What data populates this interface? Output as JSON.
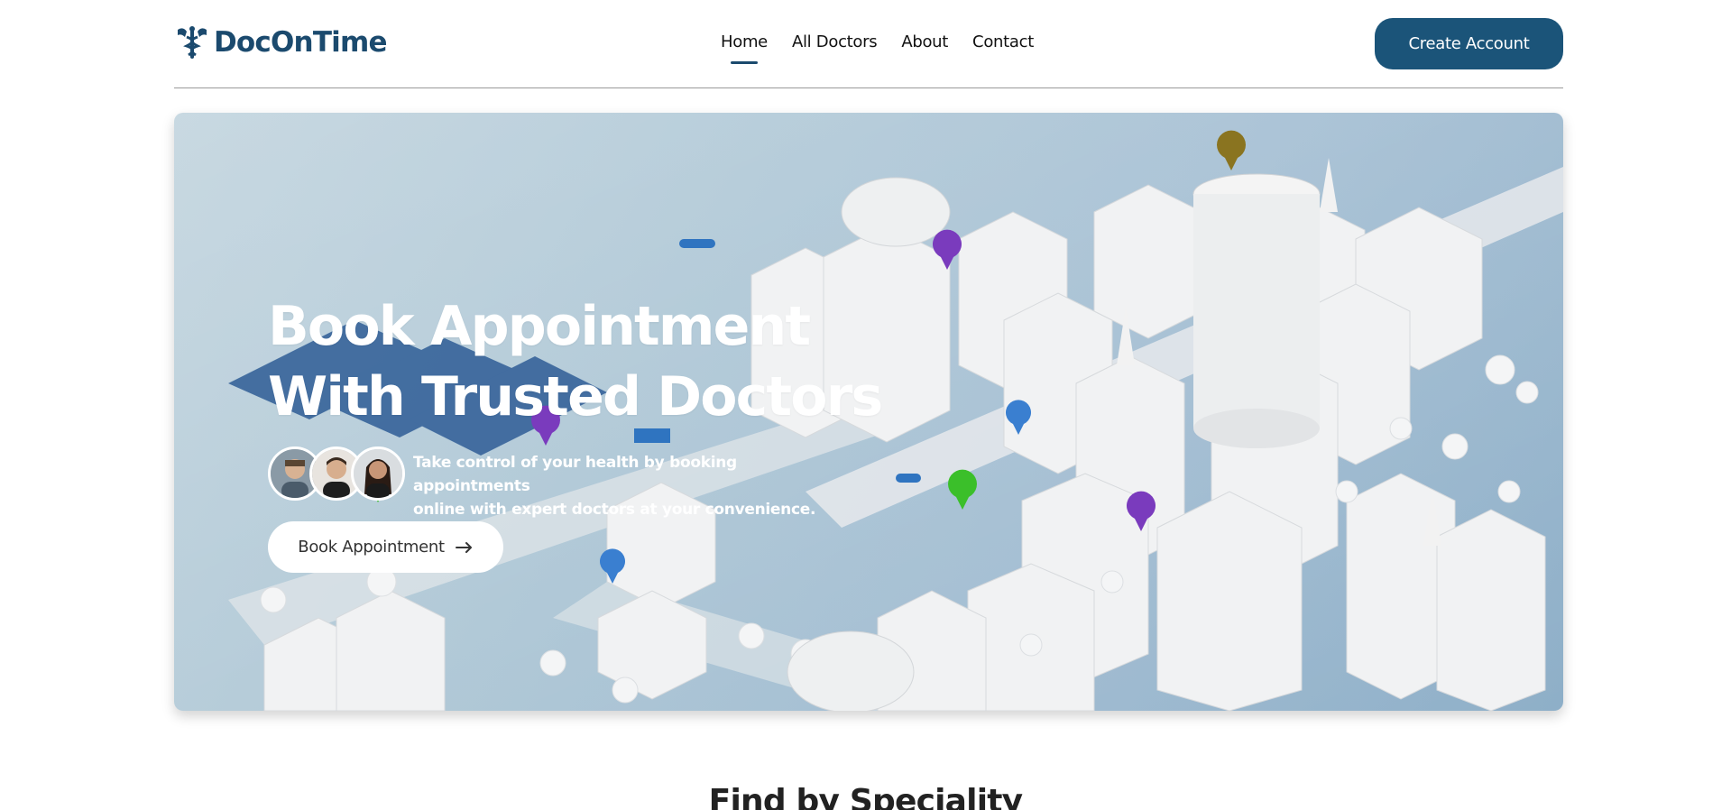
{
  "brand": {
    "name": "DocOnTime",
    "color": "#1b4a6e"
  },
  "nav": {
    "links": [
      {
        "label": "Home",
        "active": true
      },
      {
        "label": "All Doctors",
        "active": false
      },
      {
        "label": "About",
        "active": false
      },
      {
        "label": "Contact",
        "active": false
      }
    ],
    "create_account_label": "Create Account"
  },
  "hero": {
    "title_line1": "Book Appointment",
    "title_line2": "With Trusted Doctors",
    "subtitle_line1": "Take control of your health by booking appointments",
    "subtitle_line2": "online with expert doctors at your convenience.",
    "book_button_label": "Book Appointment",
    "book_button_icon": "arrow-right-icon",
    "avatar_count": 3
  },
  "sections": {
    "speciality_title": "Find by Speciality"
  },
  "colors": {
    "accent": "#1b5479",
    "nav_underline": "#1b4a6e",
    "hero_bg": "#a7c2d2"
  }
}
